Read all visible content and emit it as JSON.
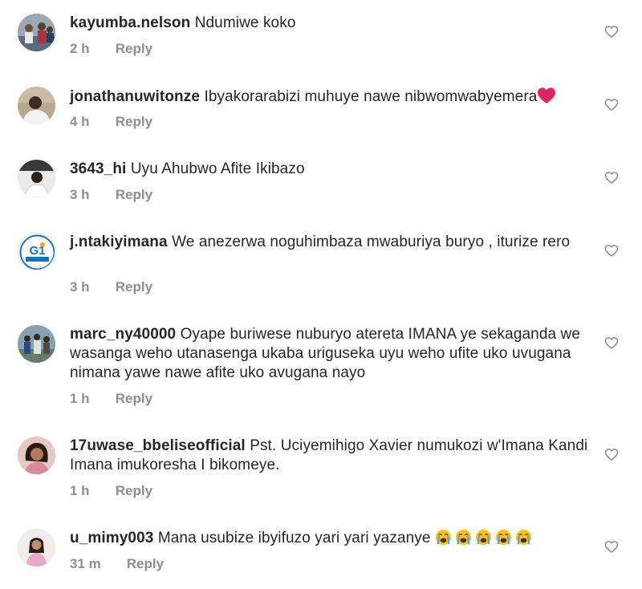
{
  "comments": [
    {
      "username": "kayumba.nelson",
      "text": "Ndumiwe koko",
      "time": "2 h",
      "reply": "Reply",
      "avatar": "group-photo-avatar"
    },
    {
      "username": "jonathanuwitonze",
      "text": "Ibyakorarabizi muhuye nawe nibwomwabyemera",
      "emoji": "red-heart",
      "time": "4 h",
      "reply": "Reply",
      "avatar": "person-photo-avatar"
    },
    {
      "username": "3643_hi",
      "text": "Uyu Ahubwo Afite Ikibazo",
      "time": "3 h",
      "reply": "Reply",
      "avatar": "person-photo-avatar"
    },
    {
      "username": "j.ntakiyimana",
      "text": "We anezerwa noguhimbaza mwaburiya buryo , iturize rero",
      "time": "3 h",
      "reply": "Reply",
      "avatar": "g1-logo-avatar",
      "avatar_logo_text": "G1"
    },
    {
      "username": "marc_ny40000",
      "text": "Oyape buriwese nuburyo atereta IMANA ye sekaganda we wasanga weho utanasenga ukaba uriguseka uyu weho ufite uko uvugana nimana yawe nawe afite uko avugana nayo",
      "time": "1 h",
      "reply": "Reply",
      "avatar": "group-photo-avatar"
    },
    {
      "username": "17uwase_bbeliseofficial",
      "text": "Pst. Uciyemihigo Xavier numukozi w'Imana Kandi Imana imukoresha I bikomeye.",
      "time": "1 h",
      "reply": "Reply",
      "avatar": "person-photo-avatar"
    },
    {
      "username": "u_mimy003",
      "text": "Mana usubize ibyifuzo yari yari yazanye",
      "emoji": "loudly-crying-face x5",
      "time": "31 m",
      "reply": "Reply",
      "avatar": "person-photo-avatar"
    }
  ],
  "colors": {
    "text": "#262626",
    "meta": "#8e8e8e",
    "heart": "#e0245e",
    "like_icon": "#8e8e8e"
  }
}
